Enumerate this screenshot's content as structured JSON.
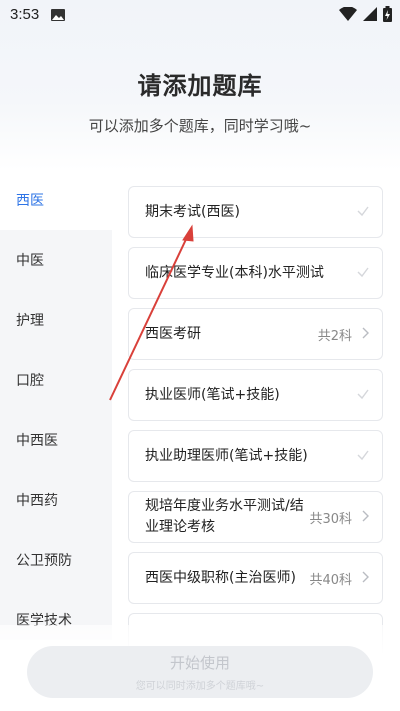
{
  "status_bar": {
    "time": "3:53",
    "icons": [
      "image-icon",
      "wifi-icon",
      "signal-icon",
      "battery-charging-icon"
    ]
  },
  "header": {
    "title": "请添加题库",
    "subtitle": "可以添加多个题库，同时学习哦~"
  },
  "sidebar": {
    "items": [
      {
        "label": "西医",
        "active": true
      },
      {
        "label": "中医",
        "active": false
      },
      {
        "label": "护理",
        "active": false
      },
      {
        "label": "口腔",
        "active": false
      },
      {
        "label": "中西医",
        "active": false
      },
      {
        "label": "中西药",
        "active": false
      },
      {
        "label": "公卫预防",
        "active": false
      },
      {
        "label": "医学技术",
        "active": false
      }
    ]
  },
  "banks": [
    {
      "title": "期末考试(西医)",
      "count": "",
      "icon": "check-icon"
    },
    {
      "title": "临床医学专业(本科)水平测试",
      "count": "",
      "icon": "check-icon"
    },
    {
      "title": "西医考研",
      "count": "共2科",
      "icon": "chevron-right-icon"
    },
    {
      "title": "执业医师(笔试+技能)",
      "count": "",
      "icon": "check-icon"
    },
    {
      "title": "执业助理医师(笔试+技能)",
      "count": "",
      "icon": "check-icon"
    },
    {
      "title": "规培年度业务水平测试/结业理论考核",
      "count": "共30科",
      "icon": "chevron-right-icon"
    },
    {
      "title": "西医中级职称(主治医师)",
      "count": "共40科",
      "icon": "chevron-right-icon"
    }
  ],
  "footer": {
    "button_label": "开始使用",
    "hint": "您可以同时添加多个题库哦~"
  },
  "colors": {
    "accent": "#2e74e6",
    "annotation_arrow": "#d9403a"
  }
}
